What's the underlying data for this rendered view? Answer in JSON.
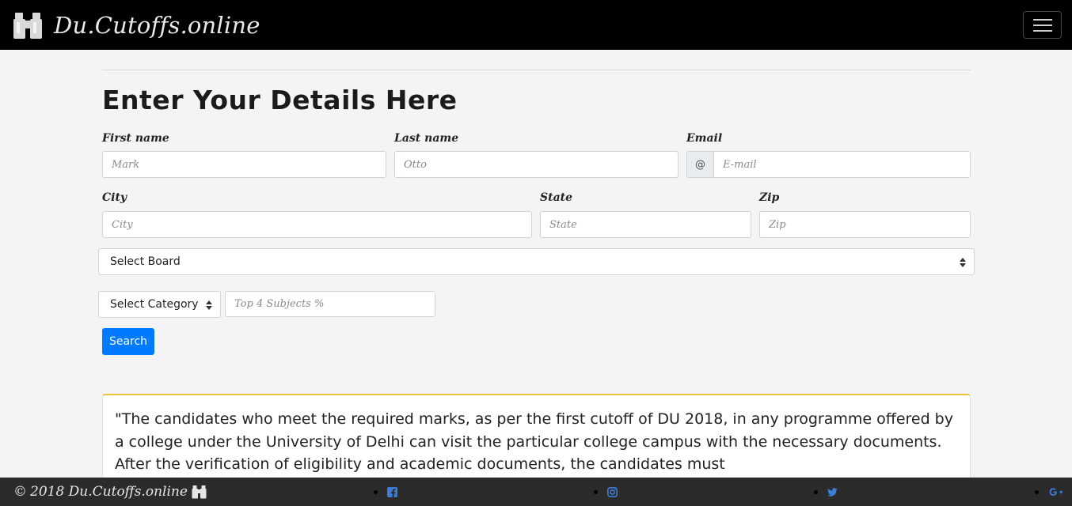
{
  "brand": {
    "name": "Du.Cutoffs.online",
    "icon": "binoculars-icon"
  },
  "nav": {
    "toggle_icon": "hamburger-icon"
  },
  "form": {
    "heading": "Enter Your Details Here",
    "first_name": {
      "label": "First name",
      "placeholder": "Mark"
    },
    "last_name": {
      "label": "Last name",
      "placeholder": "Otto"
    },
    "email": {
      "label": "Email",
      "prepend": "@",
      "placeholder": "E-mail"
    },
    "city": {
      "label": "City",
      "placeholder": "City"
    },
    "state": {
      "label": "State",
      "placeholder": "State"
    },
    "zip": {
      "label": "Zip",
      "placeholder": "Zip"
    },
    "board_select": "Select Board",
    "category_select": "Select Category",
    "subjects": {
      "placeholder": "Top 4 Subjects %"
    },
    "search_label": "Search"
  },
  "notice": {
    "text": "\"The candidates who meet the required marks, as per the first cutoff of DU 2018, in any programme offered by a college under the University of Delhi can visit the particular college campus with the necessary documents. After the verification of eligibility and academic documents, the candidates must"
  },
  "footer": {
    "copyright": "2018 Du.Cutoffs.online",
    "copyright_symbol": "©",
    "social": [
      "facebook-icon",
      "instagram-icon",
      "twitter-icon",
      "google-plus-icon"
    ]
  },
  "colors": {
    "navbar": "#000000",
    "primary": "#007bff",
    "card_accent": "#f0c13a",
    "social_icon": "#3b7dd8",
    "footer": "#2b2b2b"
  }
}
